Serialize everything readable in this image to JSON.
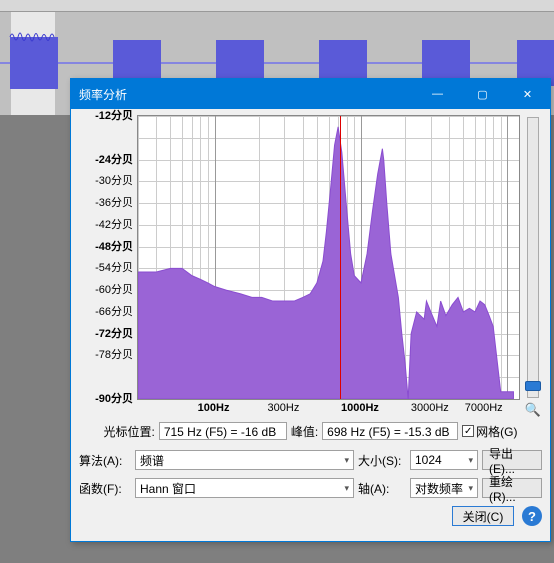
{
  "window": {
    "title": "频率分析",
    "buttons": {
      "min": "—",
      "max": "▢",
      "close": "✕"
    }
  },
  "chart_data": {
    "type": "line",
    "title": "",
    "xlabel": "Hz",
    "ylabel": "分贝",
    "x_scale": "log",
    "x_range_hz": [
      30,
      12000
    ],
    "y_range_db": [
      -90,
      -12
    ],
    "y_ticks_db": [
      -12,
      -24,
      -30,
      -36,
      -42,
      -48,
      -54,
      -60,
      -66,
      -72,
      -78,
      -90
    ],
    "y_tick_labels": [
      "-12分贝",
      "-24分贝",
      "-30分贝",
      "-36分贝",
      "-42分贝",
      "-48分贝",
      "-54分贝",
      "-60分贝",
      "-66分贝",
      "-72分贝",
      "-78分贝",
      "-90分贝"
    ],
    "y_tick_bold": [
      -12,
      -24,
      -48,
      -72,
      -90
    ],
    "x_ticks_hz": [
      100,
      300,
      1000,
      3000,
      7000
    ],
    "x_tick_labels": [
      "100Hz",
      "300Hz",
      "1000Hz",
      "3000Hz",
      "7000Hz"
    ],
    "x_tick_bold": [
      100,
      1000
    ],
    "cursor_x_hz": 715,
    "series": [
      {
        "name": "频谱",
        "color": "#8a4dd0",
        "fill": "#9a64d6",
        "points_hz_db": [
          [
            30,
            -55
          ],
          [
            40,
            -55
          ],
          [
            50,
            -54
          ],
          [
            60,
            -54
          ],
          [
            70,
            -56
          ],
          [
            80,
            -57
          ],
          [
            90,
            -58
          ],
          [
            100,
            -59
          ],
          [
            120,
            -60
          ],
          [
            150,
            -61
          ],
          [
            180,
            -62
          ],
          [
            210,
            -62
          ],
          [
            250,
            -63
          ],
          [
            300,
            -63
          ],
          [
            350,
            -63
          ],
          [
            400,
            -62
          ],
          [
            450,
            -61
          ],
          [
            500,
            -58
          ],
          [
            550,
            -52
          ],
          [
            580,
            -44
          ],
          [
            620,
            -32
          ],
          [
            660,
            -20
          ],
          [
            698,
            -15
          ],
          [
            740,
            -22
          ],
          [
            800,
            -38
          ],
          [
            850,
            -50
          ],
          [
            900,
            -56
          ],
          [
            1000,
            -58
          ],
          [
            1100,
            -50
          ],
          [
            1200,
            -38
          ],
          [
            1300,
            -28
          ],
          [
            1400,
            -21
          ],
          [
            1430,
            -24
          ],
          [
            1500,
            -36
          ],
          [
            1600,
            -50
          ],
          [
            1800,
            -62
          ],
          [
            1900,
            -72
          ],
          [
            2000,
            -80
          ],
          [
            2100,
            -90
          ],
          [
            2200,
            -72
          ],
          [
            2400,
            -66
          ],
          [
            2700,
            -68
          ],
          [
            2800,
            -63
          ],
          [
            3000,
            -66
          ],
          [
            3300,
            -70
          ],
          [
            3500,
            -63
          ],
          [
            3800,
            -67
          ],
          [
            4200,
            -64
          ],
          [
            4600,
            -62
          ],
          [
            5000,
            -66
          ],
          [
            5500,
            -65
          ],
          [
            6000,
            -66
          ],
          [
            6500,
            -63
          ],
          [
            7000,
            -64
          ],
          [
            7500,
            -67
          ],
          [
            8000,
            -70
          ],
          [
            9000,
            -88
          ],
          [
            10000,
            -88
          ],
          [
            11000,
            -88
          ]
        ]
      }
    ]
  },
  "cursor_info": {
    "pos_label": "光标位置:",
    "pos_value": "715 Hz (F5) = -16 dB",
    "peak_label": "峰值:",
    "peak_value": "698 Hz (F5) = -15.3 dB"
  },
  "grid_checkbox": {
    "label": "网格(G)",
    "checked": true
  },
  "controls": {
    "algorithm_label": "算法(A):",
    "algorithm_value": "频谱",
    "size_label": "大小(S):",
    "size_value": "1024",
    "export_label": "导出(E)...",
    "function_label": "函数(F):",
    "function_value": "Hann 窗口",
    "axis_label": "轴(A):",
    "axis_value": "对数频率",
    "replot_label": "重绘(R)..."
  },
  "close_button_label": "关闭(C)",
  "slider": {
    "top_tick": "−",
    "thumb_pos_frac": 0.98
  }
}
